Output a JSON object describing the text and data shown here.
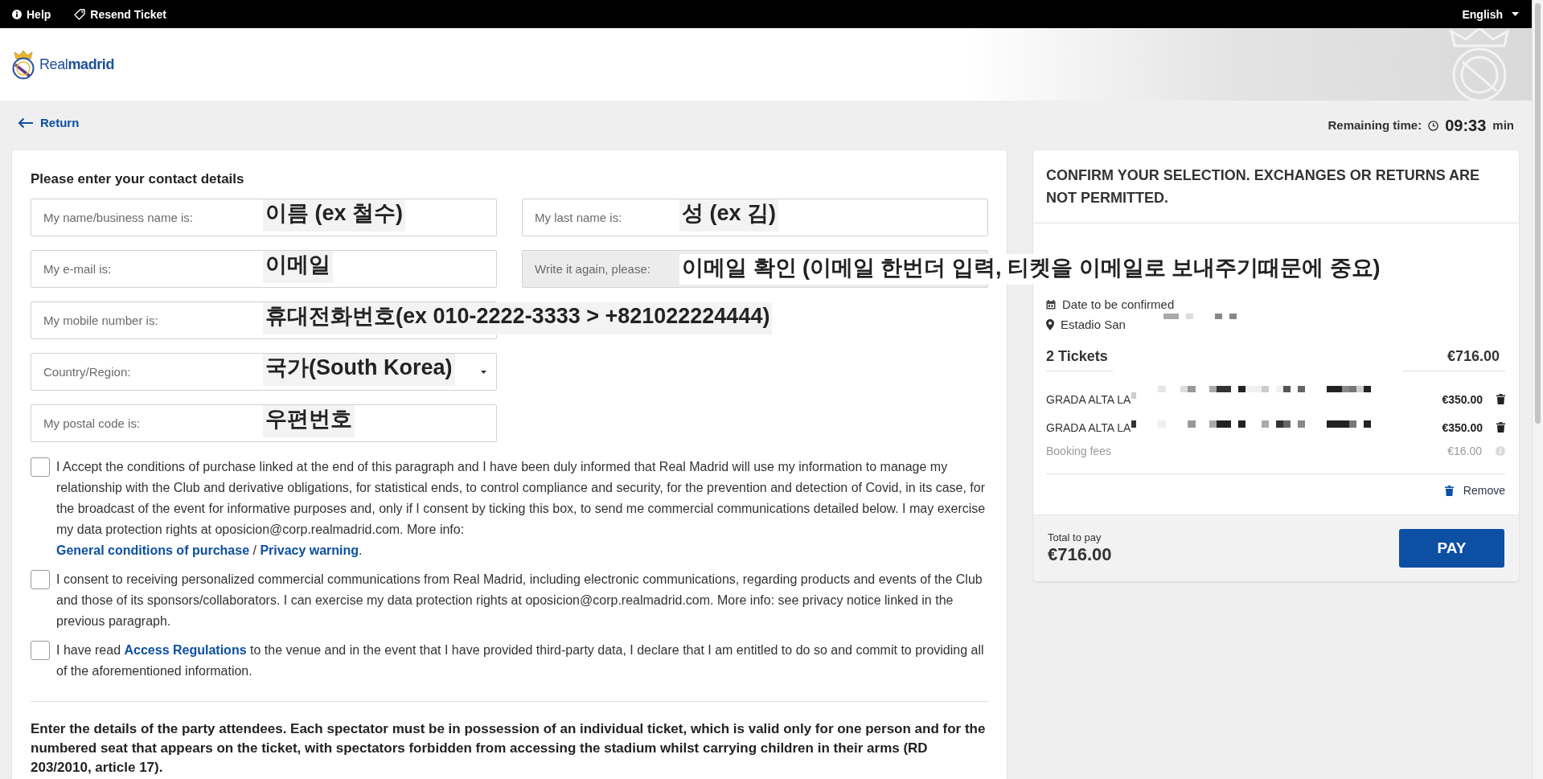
{
  "top_bar": {
    "help": "Help",
    "resend_ticket": "Resend Ticket",
    "language": "English"
  },
  "header": {
    "logo": "Real**madrid**"
  },
  "nav": {
    "return": "Return",
    "remaining_label": "Remaining time:",
    "remaining_time": "09:33",
    "remaining_unit": "min"
  },
  "contact_form": {
    "title": "Please enter your contact details",
    "rows": [
      [
        {
          "kind": "text",
          "label": "My name/business name is:",
          "hint": "이름 (ex 철수)",
          "disabled": false
        },
        {
          "kind": "text",
          "label": "My last name is:",
          "hint": "성 (ex 김)",
          "disabled": false
        }
      ],
      [
        {
          "kind": "text",
          "label": "My e-mail is:",
          "hint": "이메일",
          "disabled": false
        },
        {
          "kind": "text",
          "label": "Write it again, please:",
          "hint": "이메일 확인 (이메일 한번더 입력, 티켓을 이메일로 보내주기때문에 중요)",
          "disabled": true
        }
      ],
      [
        {
          "kind": "text",
          "label": "My mobile number is:",
          "hint": "휴대전화번호(ex 010-2222-3333 > +821022224444)",
          "disabled": false
        }
      ],
      [
        {
          "kind": "select",
          "label": "Country/Region:",
          "hint": "국가(South Korea)",
          "disabled": false
        }
      ],
      [
        {
          "kind": "text",
          "label": "My postal code is:",
          "hint": "우편번호",
          "disabled": false
        }
      ]
    ]
  },
  "consents": [
    {
      "checked": false,
      "parts": [
        {
          "kind": "text",
          "text": "I Accept the conditions of purchase linked at the end of this paragraph and I have been duly informed that Real Madrid will use my information to manage my relationship with the Club and derivative obligations, for statistical ends, to control compliance and security, for the prevention and detection of Covid, in its case, for the broadcast of the event for informative purposes and, only if I consent by ticking this box, to send me commercial communications detailed below. I may exercise my data protection rights at oposicion@corp.realmadrid.com. More info:"
        },
        {
          "kind": "break"
        },
        {
          "kind": "link",
          "text": "General conditions of purchase"
        },
        {
          "kind": "text",
          "text": " / "
        },
        {
          "kind": "link",
          "text": "Privacy warning"
        },
        {
          "kind": "text",
          "text": "."
        }
      ]
    },
    {
      "checked": false,
      "parts": [
        {
          "kind": "text",
          "text": "I consent to receiving personalized commercial communications from Real Madrid, including electronic communications, regarding products and events of the Club and those of its sponsors/collaborators. I can exercise my data protection rights at oposicion@corp.realmadrid.com. More info: see privacy notice linked in the previous paragraph."
        }
      ]
    },
    {
      "checked": false,
      "parts": [
        {
          "kind": "text",
          "text": "I have read "
        },
        {
          "kind": "link",
          "text": "Access Regulations"
        },
        {
          "kind": "text",
          "text": " to the venue and in the event that I have provided third-party data, I declare that I am entitled to do so and commit to providing all of the aforementioned information."
        }
      ]
    }
  ],
  "attendees_notice": "Enter the details of the party attendees. Each spectator must be in possession of an individual ticket, which is valid only for one person and for the numbered seat that appears on the ticket, with spectators forbidden from accessing the stadium whilst carrying children in their arms (RD 203/2010, article 17).",
  "order_summary": {
    "title": "CONFIRM YOUR SELECTION. EXCHANGES OR RETURNS ARE NOT PERMITTED.",
    "date": "Date to be confirmed",
    "venue": "Estadio San",
    "tickets_label": "2 Tickets",
    "tickets_total": "€716.00",
    "items": [
      {
        "name": "GRADA ALTA LA",
        "price": "€350.00"
      },
      {
        "name": "GRADA ALTA LA",
        "price": "€350.00"
      }
    ],
    "fees_label": "Booking fees",
    "fees_amount": "€16.00",
    "remove": "Remove",
    "total_label": "Total to pay",
    "total": "€716.00",
    "pay": "PAY"
  }
}
